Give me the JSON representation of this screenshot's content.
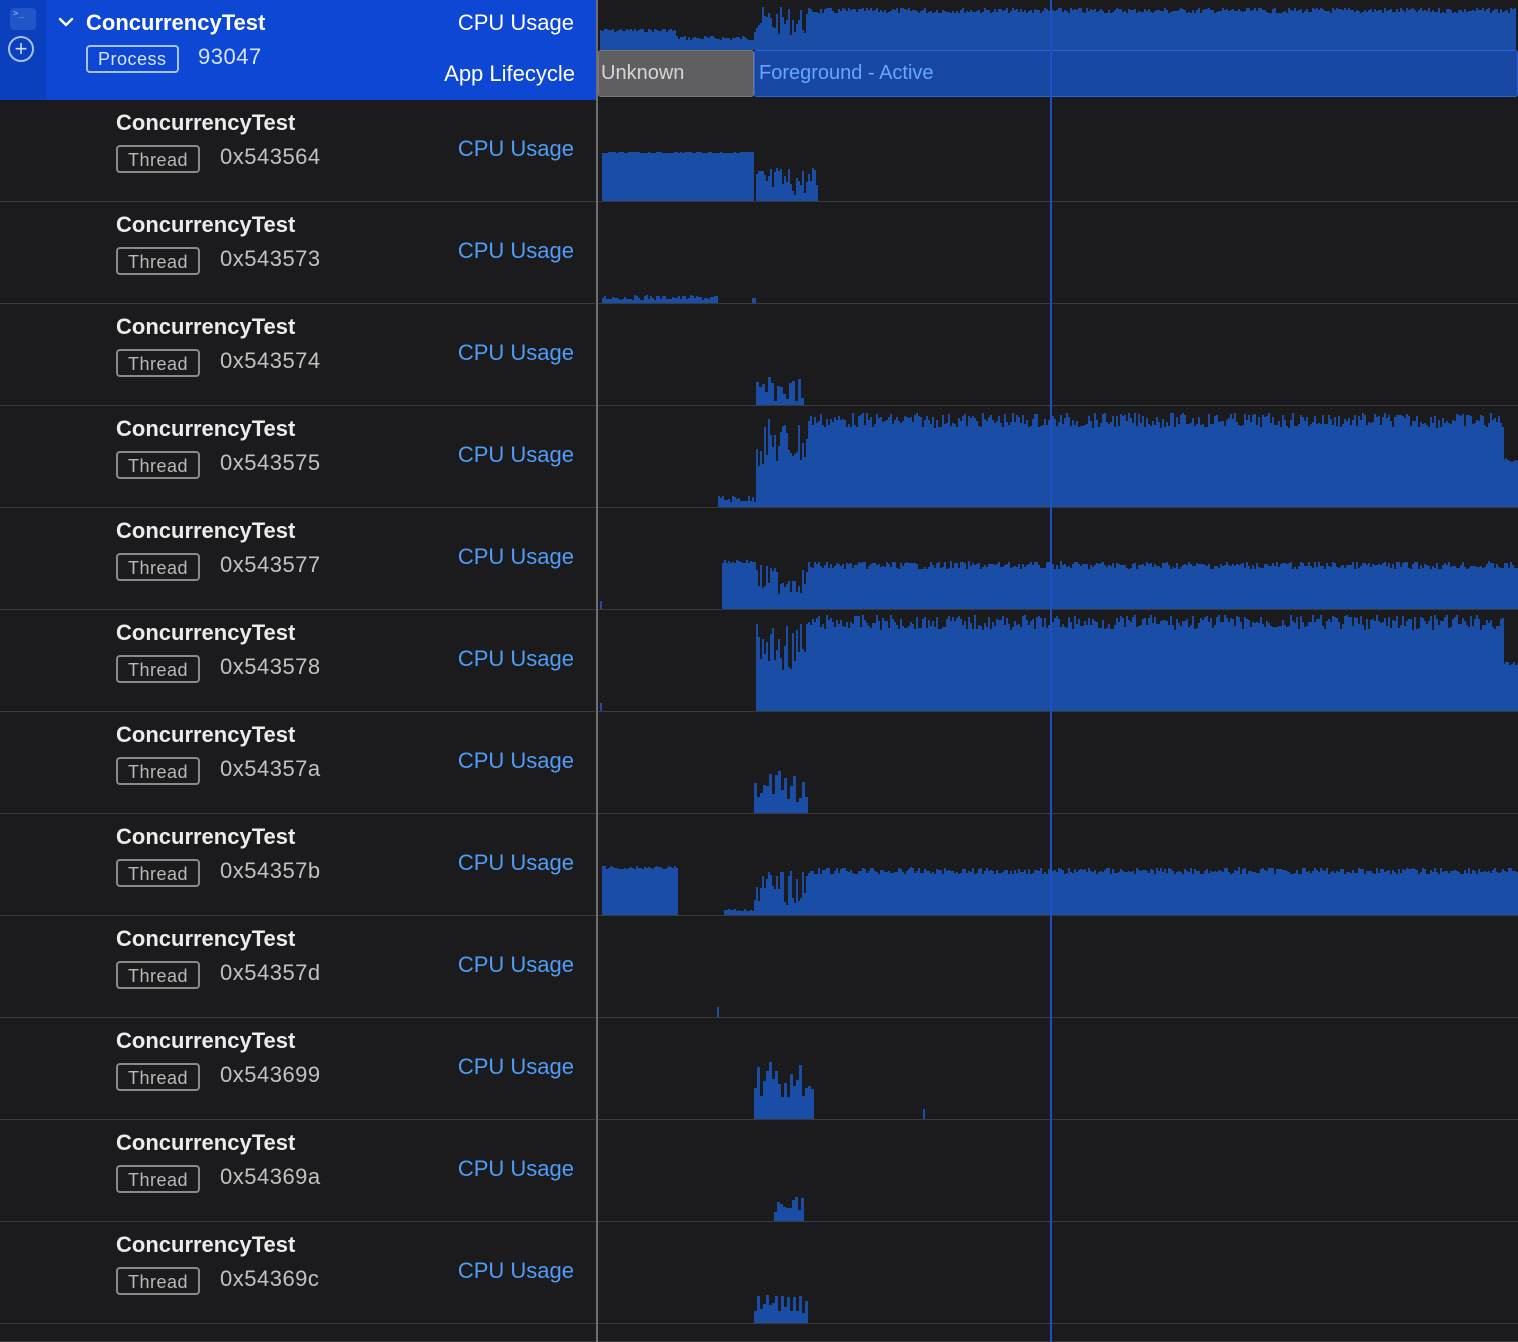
{
  "process": {
    "name": "ConcurrencyTest",
    "badge": "Process",
    "pid": "93047",
    "cpu_label": "CPU Usage",
    "lifecycle_label": "App Lifecycle",
    "lifecycle_states": [
      "Unknown",
      "Foreground - Active"
    ]
  },
  "threads": [
    {
      "name": "ConcurrencyTest",
      "badge": "Thread",
      "tid": "0x543564",
      "cpu_label": "CPU Usage"
    },
    {
      "name": "ConcurrencyTest",
      "badge": "Thread",
      "tid": "0x543573",
      "cpu_label": "CPU Usage"
    },
    {
      "name": "ConcurrencyTest",
      "badge": "Thread",
      "tid": "0x543574",
      "cpu_label": "CPU Usage"
    },
    {
      "name": "ConcurrencyTest",
      "badge": "Thread",
      "tid": "0x543575",
      "cpu_label": "CPU Usage"
    },
    {
      "name": "ConcurrencyTest",
      "badge": "Thread",
      "tid": "0x543577",
      "cpu_label": "CPU Usage"
    },
    {
      "name": "ConcurrencyTest",
      "badge": "Thread",
      "tid": "0x543578",
      "cpu_label": "CPU Usage"
    },
    {
      "name": "ConcurrencyTest",
      "badge": "Thread",
      "tid": "0x54357a",
      "cpu_label": "CPU Usage"
    },
    {
      "name": "ConcurrencyTest",
      "badge": "Thread",
      "tid": "0x54357b",
      "cpu_label": "CPU Usage"
    },
    {
      "name": "ConcurrencyTest",
      "badge": "Thread",
      "tid": "0x54357d",
      "cpu_label": "CPU Usage"
    },
    {
      "name": "ConcurrencyTest",
      "badge": "Thread",
      "tid": "0x543699",
      "cpu_label": "CPU Usage"
    },
    {
      "name": "ConcurrencyTest",
      "badge": "Thread",
      "tid": "0x54369a",
      "cpu_label": "CPU Usage"
    },
    {
      "name": "ConcurrencyTest",
      "badge": "Thread",
      "tid": "0x54369c",
      "cpu_label": "CPU Usage"
    }
  ],
  "colors": {
    "accent": "#0d47d3",
    "graph_fill": "#1a4ea6",
    "cpu_label": "#4f9df7",
    "cursor": "#1e4fc4"
  },
  "icons": [
    "terminal-icon",
    "add-circle-icon",
    "chevron-down-icon"
  ]
}
